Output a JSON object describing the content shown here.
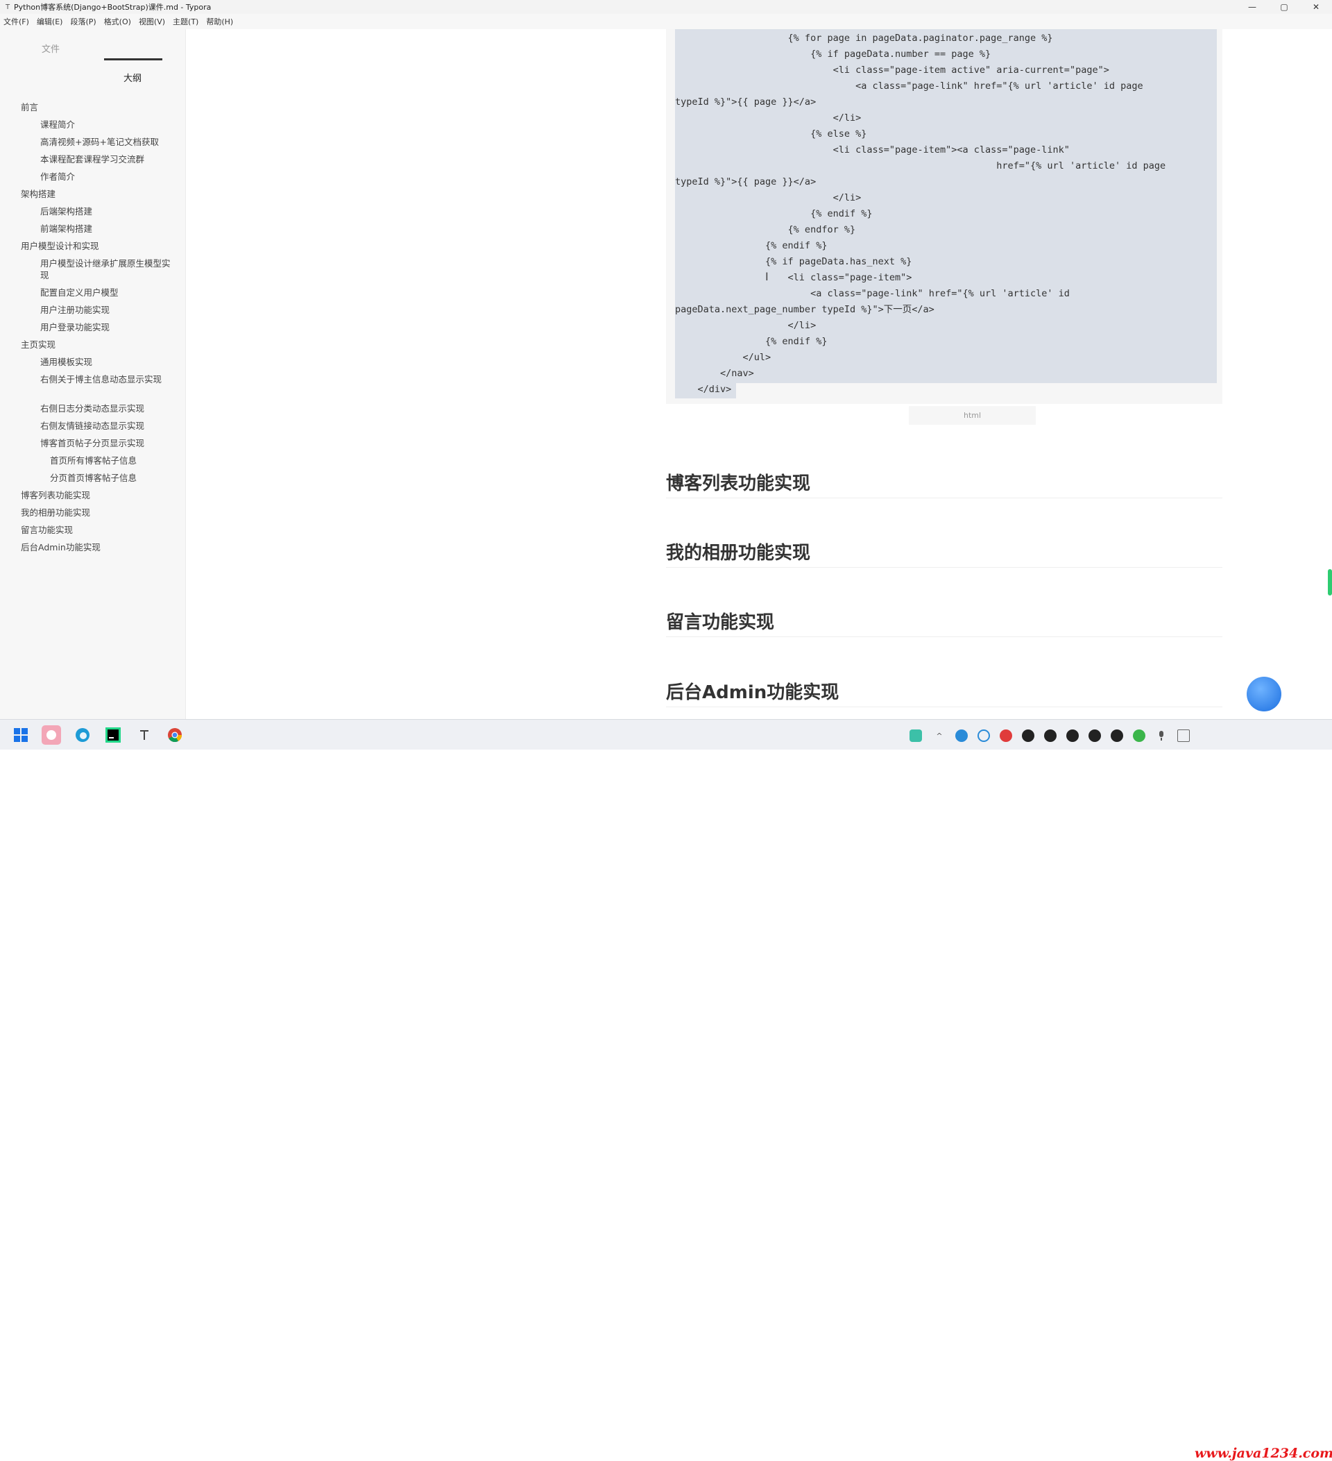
{
  "window": {
    "title": "Python博客系统(Django+BootStrap)课件.md - Typora",
    "app_icon": "T",
    "minimize_icon": "—",
    "maximize_icon": "▢",
    "close_icon": "✕"
  },
  "menu": [
    "文件(F)",
    "编辑(E)",
    "段落(P)",
    "格式(O)",
    "视图(V)",
    "主题(T)",
    "帮助(H)"
  ],
  "sidebar": {
    "tabs": {
      "files": "文件",
      "outline": "大纲"
    },
    "outline": [
      "前言",
      "课程简介",
      "高清视频+源码+笔记文档获取",
      "本课程配套课程学习交流群",
      "作者简介",
      "架构搭建",
      "后端架构搭建",
      "前端架构搭建",
      "用户模型设计和实现",
      "用户模型设计继承扩展原生模型实现",
      "配置自定义用户模型",
      "用户注册功能实现",
      "用户登录功能实现",
      "主页实现",
      "通用模板实现",
      "右侧关于博主信息动态显示实现",
      "右侧日志分类动态显示实现",
      "右侧友情链接动态显示实现",
      "博客首页帖子分页显示实现",
      "首页所有博客帖子信息",
      "分页首页博客帖子信息",
      "博客列表功能实现",
      "我的相册功能实现",
      "留言功能实现",
      "后台Admin功能实现"
    ]
  },
  "code": {
    "lines": [
      "                    {% for page in pageData.paginator.page_range %}",
      "                        {% if pageData.number == page %}",
      "                            <li class=\"page-item active\" aria-current=\"page\">",
      "                                <a class=\"page-link\" href=\"{% url 'article' id page",
      "typeId %}\">{{ page }}</a>",
      "                            </li>",
      "                        {% else %}",
      "                            <li class=\"page-item\"><a class=\"page-link\"",
      "                                                         href=\"{% url 'article' id page",
      "typeId %}\">{{ page }}</a>",
      "                            </li>",
      "                        {% endif %}",
      "                    {% endfor %}",
      "                {% endif %}",
      "                {% if pageData.has_next %}",
      "                    <li class=\"page-item\">",
      "                        <a class=\"page-link\" href=\"{% url 'article' id",
      "pageData.next_page_number typeId %}\">下一页</a>",
      "                    </li>",
      "                {% endif %}",
      "            </ul>",
      "        </nav>",
      "    </div>"
    ],
    "language": "html"
  },
  "headings": [
    "博客列表功能实现",
    "我的相册功能实现",
    "留言功能实现",
    "后台Admin功能实现"
  ],
  "taskbar": {
    "apps": [
      "windows-start",
      "app-pink",
      "edge",
      "pycharm",
      "typora",
      "chrome"
    ],
    "watermark": "www.java1234.com"
  },
  "colors": {
    "code_selection": "#dbe0e8",
    "watermark": "#e8191c",
    "accent_green": "#2ecc71"
  }
}
